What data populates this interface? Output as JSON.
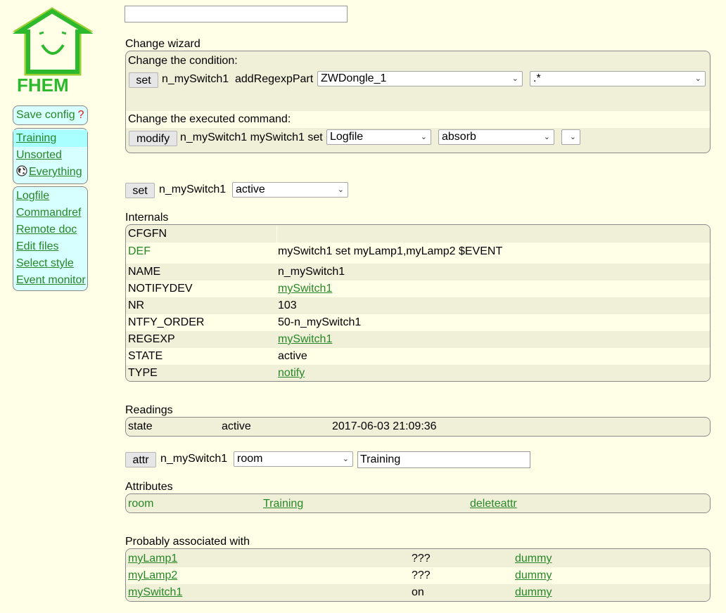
{
  "logo": {
    "text": "FHEM",
    "color": "#2DB92D"
  },
  "search": {
    "value": ""
  },
  "sidebar": {
    "save_config": "Save config",
    "save_help": "?",
    "rooms": [
      {
        "label": "Training"
      },
      {
        "label": "Unsorted"
      },
      {
        "label": "Everything"
      }
    ],
    "tools": [
      {
        "label": "Logfile"
      },
      {
        "label": "Commandref"
      },
      {
        "label": "Remote doc"
      },
      {
        "label": "Edit files"
      },
      {
        "label": "Select style"
      },
      {
        "label": "Event monitor"
      }
    ]
  },
  "wizard": {
    "title": "Change wizard",
    "cond_label": "Change the condition:",
    "set_btn": "set",
    "cond_device": "n_mySwitch1",
    "cond_action": "addRegexpPart",
    "cond_select1": "ZWDongle_1",
    "cond_select2": ".*",
    "cmd_label": "Change the executed command:",
    "modify_btn": "modify",
    "cmd_text": "n_mySwitch1 mySwitch1 set",
    "cmd_select1": "Logfile",
    "cmd_select2": "absorb",
    "cmd_select3": ""
  },
  "setline": {
    "btn": "set",
    "device": "n_mySwitch1",
    "value": "active"
  },
  "internals": {
    "title": "Internals",
    "rows": [
      {
        "key": "CFGFN",
        "value": ""
      },
      {
        "key": "DEF",
        "value": "mySwitch1 set myLamp1,myLamp2 $EVENT"
      },
      {
        "key": "NAME",
        "value": "n_mySwitch1"
      },
      {
        "key": "NOTIFYDEV",
        "value": "mySwitch1"
      },
      {
        "key": "NR",
        "value": "103"
      },
      {
        "key": "NTFY_ORDER",
        "value": "50-n_mySwitch1"
      },
      {
        "key": "REGEXP",
        "value": "mySwitch1"
      },
      {
        "key": "STATE",
        "value": "active"
      },
      {
        "key": "TYPE",
        "value": "notify"
      }
    ]
  },
  "readings": {
    "title": "Readings",
    "rows": [
      {
        "name": "state",
        "value": "active",
        "time": "2017-06-03 21:09:36"
      }
    ]
  },
  "attrline": {
    "btn": "attr",
    "device": "n_mySwitch1",
    "select": "room",
    "value": "Training"
  },
  "attributes": {
    "title": "Attributes",
    "rows": [
      {
        "name": "room",
        "value": "Training",
        "action": "deleteattr"
      }
    ]
  },
  "assoc": {
    "title": "Probably associated with",
    "rows": [
      {
        "name": "myLamp1",
        "state": "???",
        "type": "dummy"
      },
      {
        "name": "myLamp2",
        "state": "???",
        "type": "dummy"
      },
      {
        "name": "mySwitch1",
        "state": "on",
        "type": "dummy"
      }
    ]
  }
}
